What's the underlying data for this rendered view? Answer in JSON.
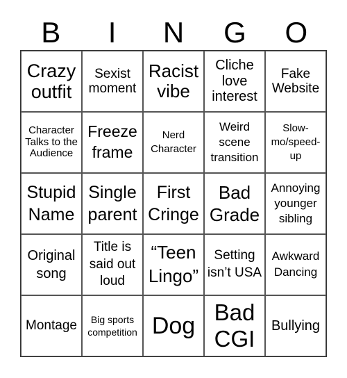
{
  "header": [
    "B",
    "I",
    "N",
    "G",
    "O"
  ],
  "cells": [
    "Crazy outfit",
    "Sexist moment",
    "Racist vibe",
    "Cliche love interest",
    "Fake Website",
    "Character Talks to the Audience",
    "Freeze frame",
    "Nerd Character",
    "Weird scene transition",
    "Slow-mo/speed-up",
    "Stupid Name",
    "Single parent",
    "First Cringe",
    "Bad Grade",
    "Annoying younger sibling",
    "Original song",
    "Title is said out loud",
    "“Teen Lingo”",
    "Setting isn’t USA",
    "Awkward Dancing",
    "Montage",
    "Big sports competition",
    "Dog",
    "Bad CGI",
    "Bullying"
  ]
}
